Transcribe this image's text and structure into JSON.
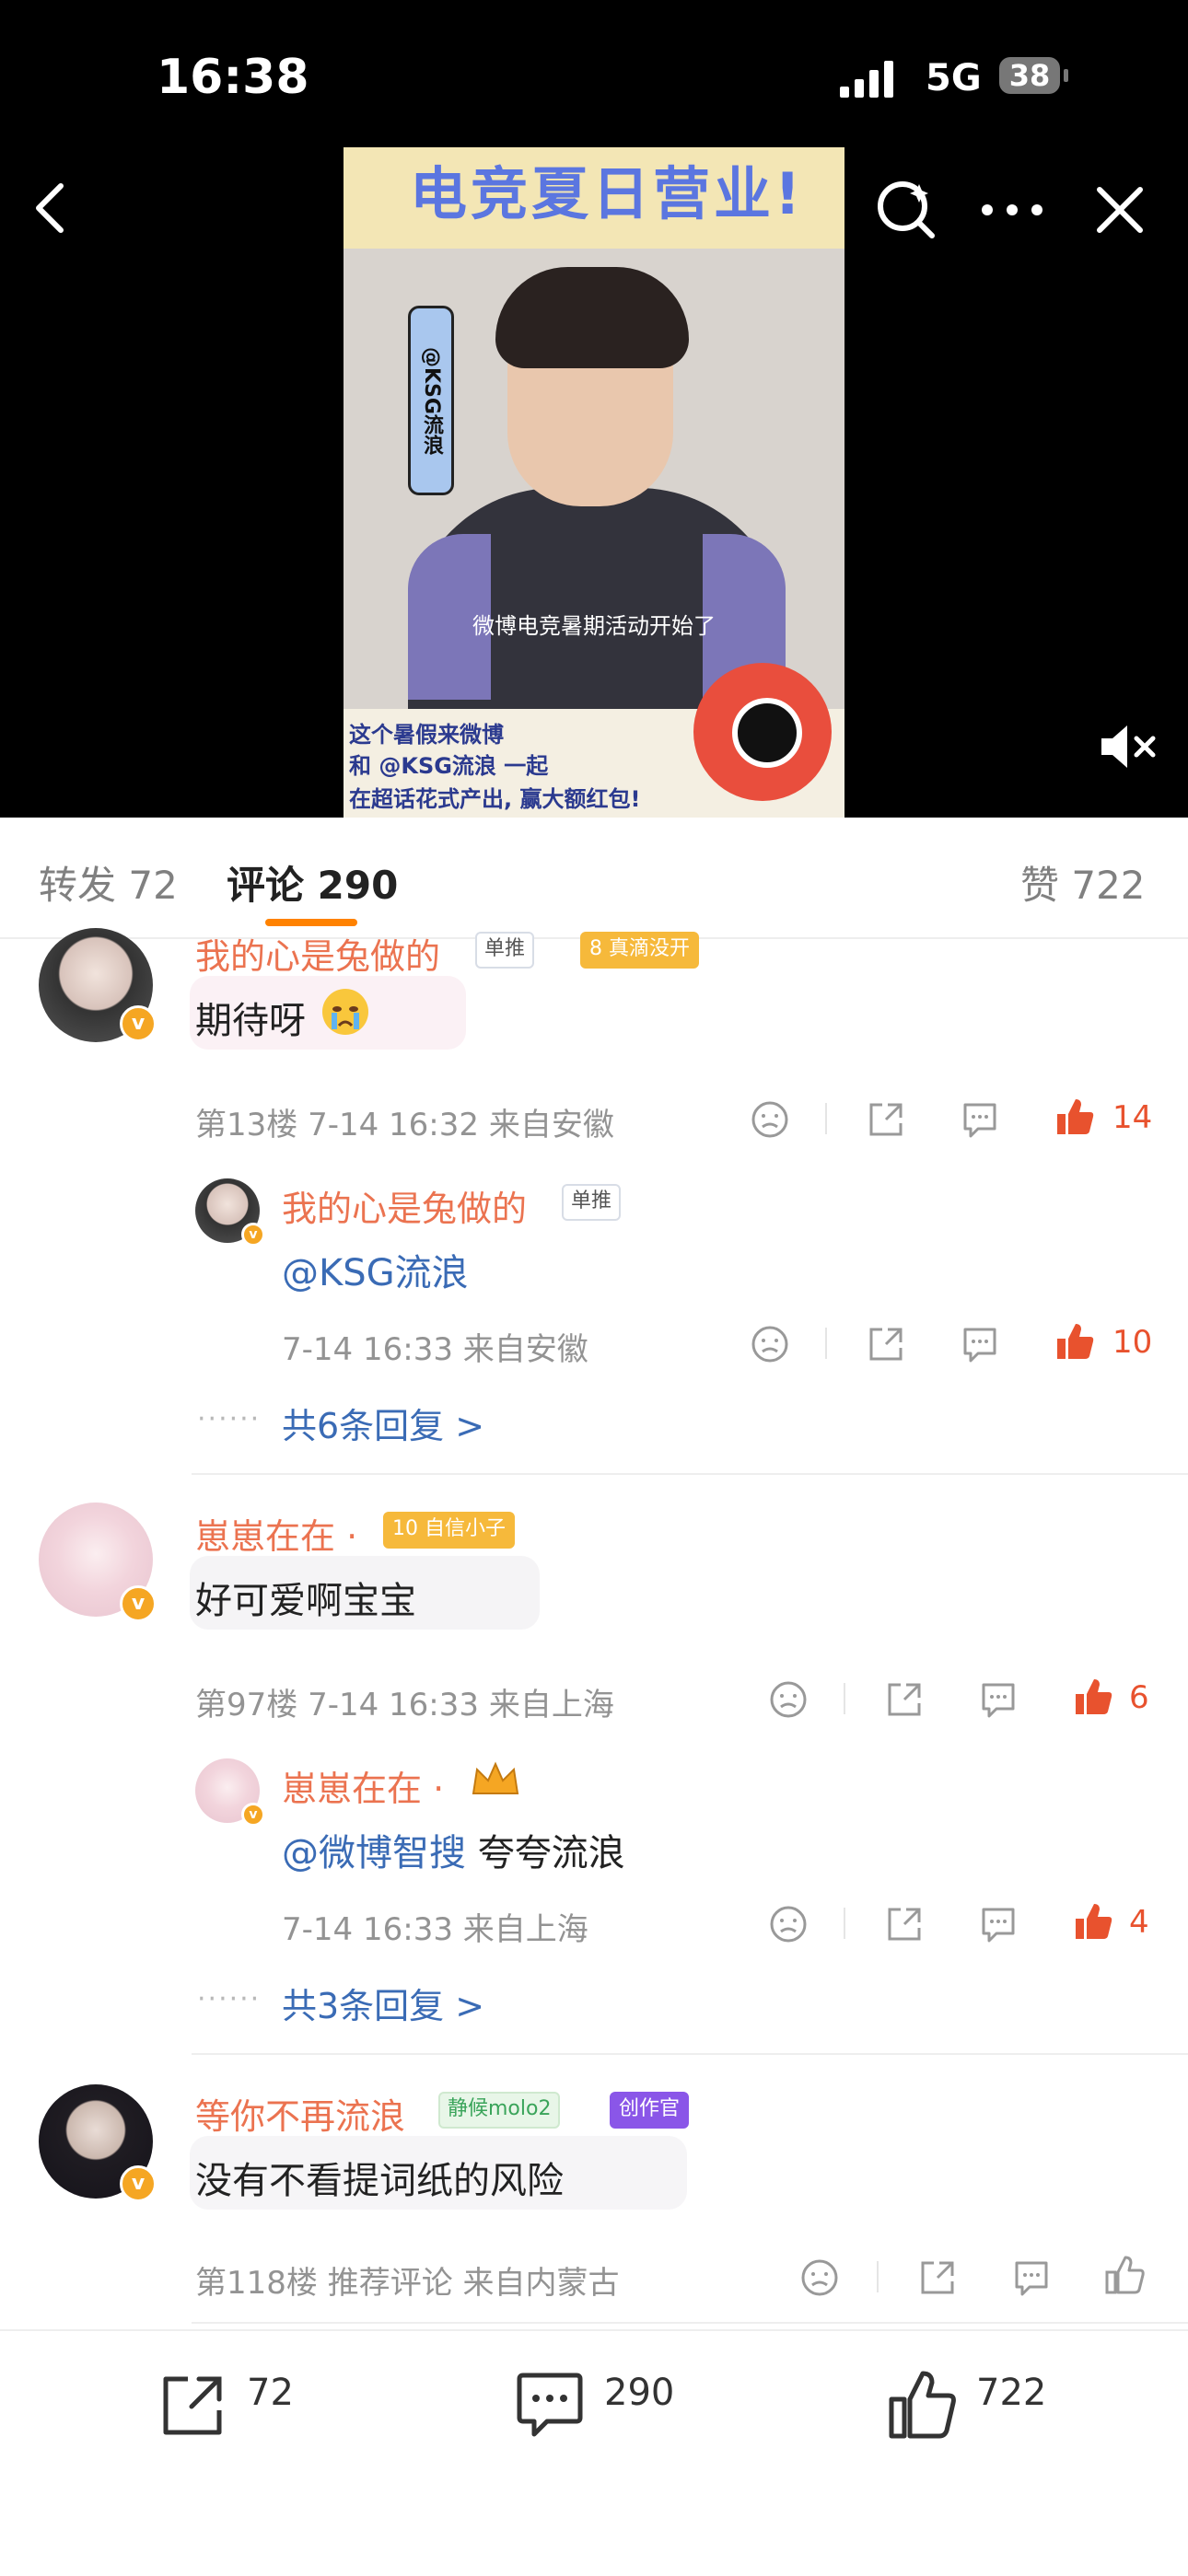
{
  "status_bar": {
    "time": "16:38",
    "network": "5G",
    "battery": "38"
  },
  "video": {
    "banner": "电竞夏日营业!",
    "tag": "@KSG流浪",
    "caption": "微博电竞暑期活动开始了",
    "bottom_line1": "这个暑假来微博",
    "bottom_line2": "和 @KSG流浪 一起",
    "bottom_line3": "在超话花式产出, 赢大额红包!"
  },
  "tabs": {
    "repost_label": "转发 72",
    "comment_label": "评论 290",
    "like_label": "赞 722"
  },
  "comments": [
    {
      "user": "我的心是兔做的",
      "badge1": "单推",
      "badge2": "8 真滴没开",
      "text": "期待呀",
      "meta": "第13楼  7-14 16:32  来自安徽",
      "likes": "14",
      "reply": {
        "user": "我的心是兔做的",
        "badge": "单推",
        "text": "@KSG流浪",
        "meta": "7-14 16:33  来自安徽",
        "likes": "10"
      },
      "more": "共6条回复 >"
    },
    {
      "user": "崽崽在在 ·",
      "badge1": "10 自信小子",
      "text": "好可爱啊宝宝",
      "meta": "第97楼  7-14 16:33  来自上海",
      "likes": "6",
      "reply": {
        "user": "崽崽在在 ·",
        "mention": "@微博智搜",
        "text": " 夸夸流浪",
        "meta": "7-14 16:33  来自上海",
        "likes": "4"
      },
      "more": "共3条回复 >"
    },
    {
      "user": "等你不再流浪",
      "badge1": "静候molo2",
      "badge2": "创作官",
      "text": "没有不看提词纸的风险",
      "meta": "第118楼  推荐评论  来自内蒙古"
    }
  ],
  "bottom_bar": {
    "repost": "72",
    "comment": "290",
    "like": "722"
  },
  "colors": {
    "accent": "#ff8200",
    "username": "#eb7350",
    "link": "#3a6bb5",
    "like": "#e8522e"
  }
}
